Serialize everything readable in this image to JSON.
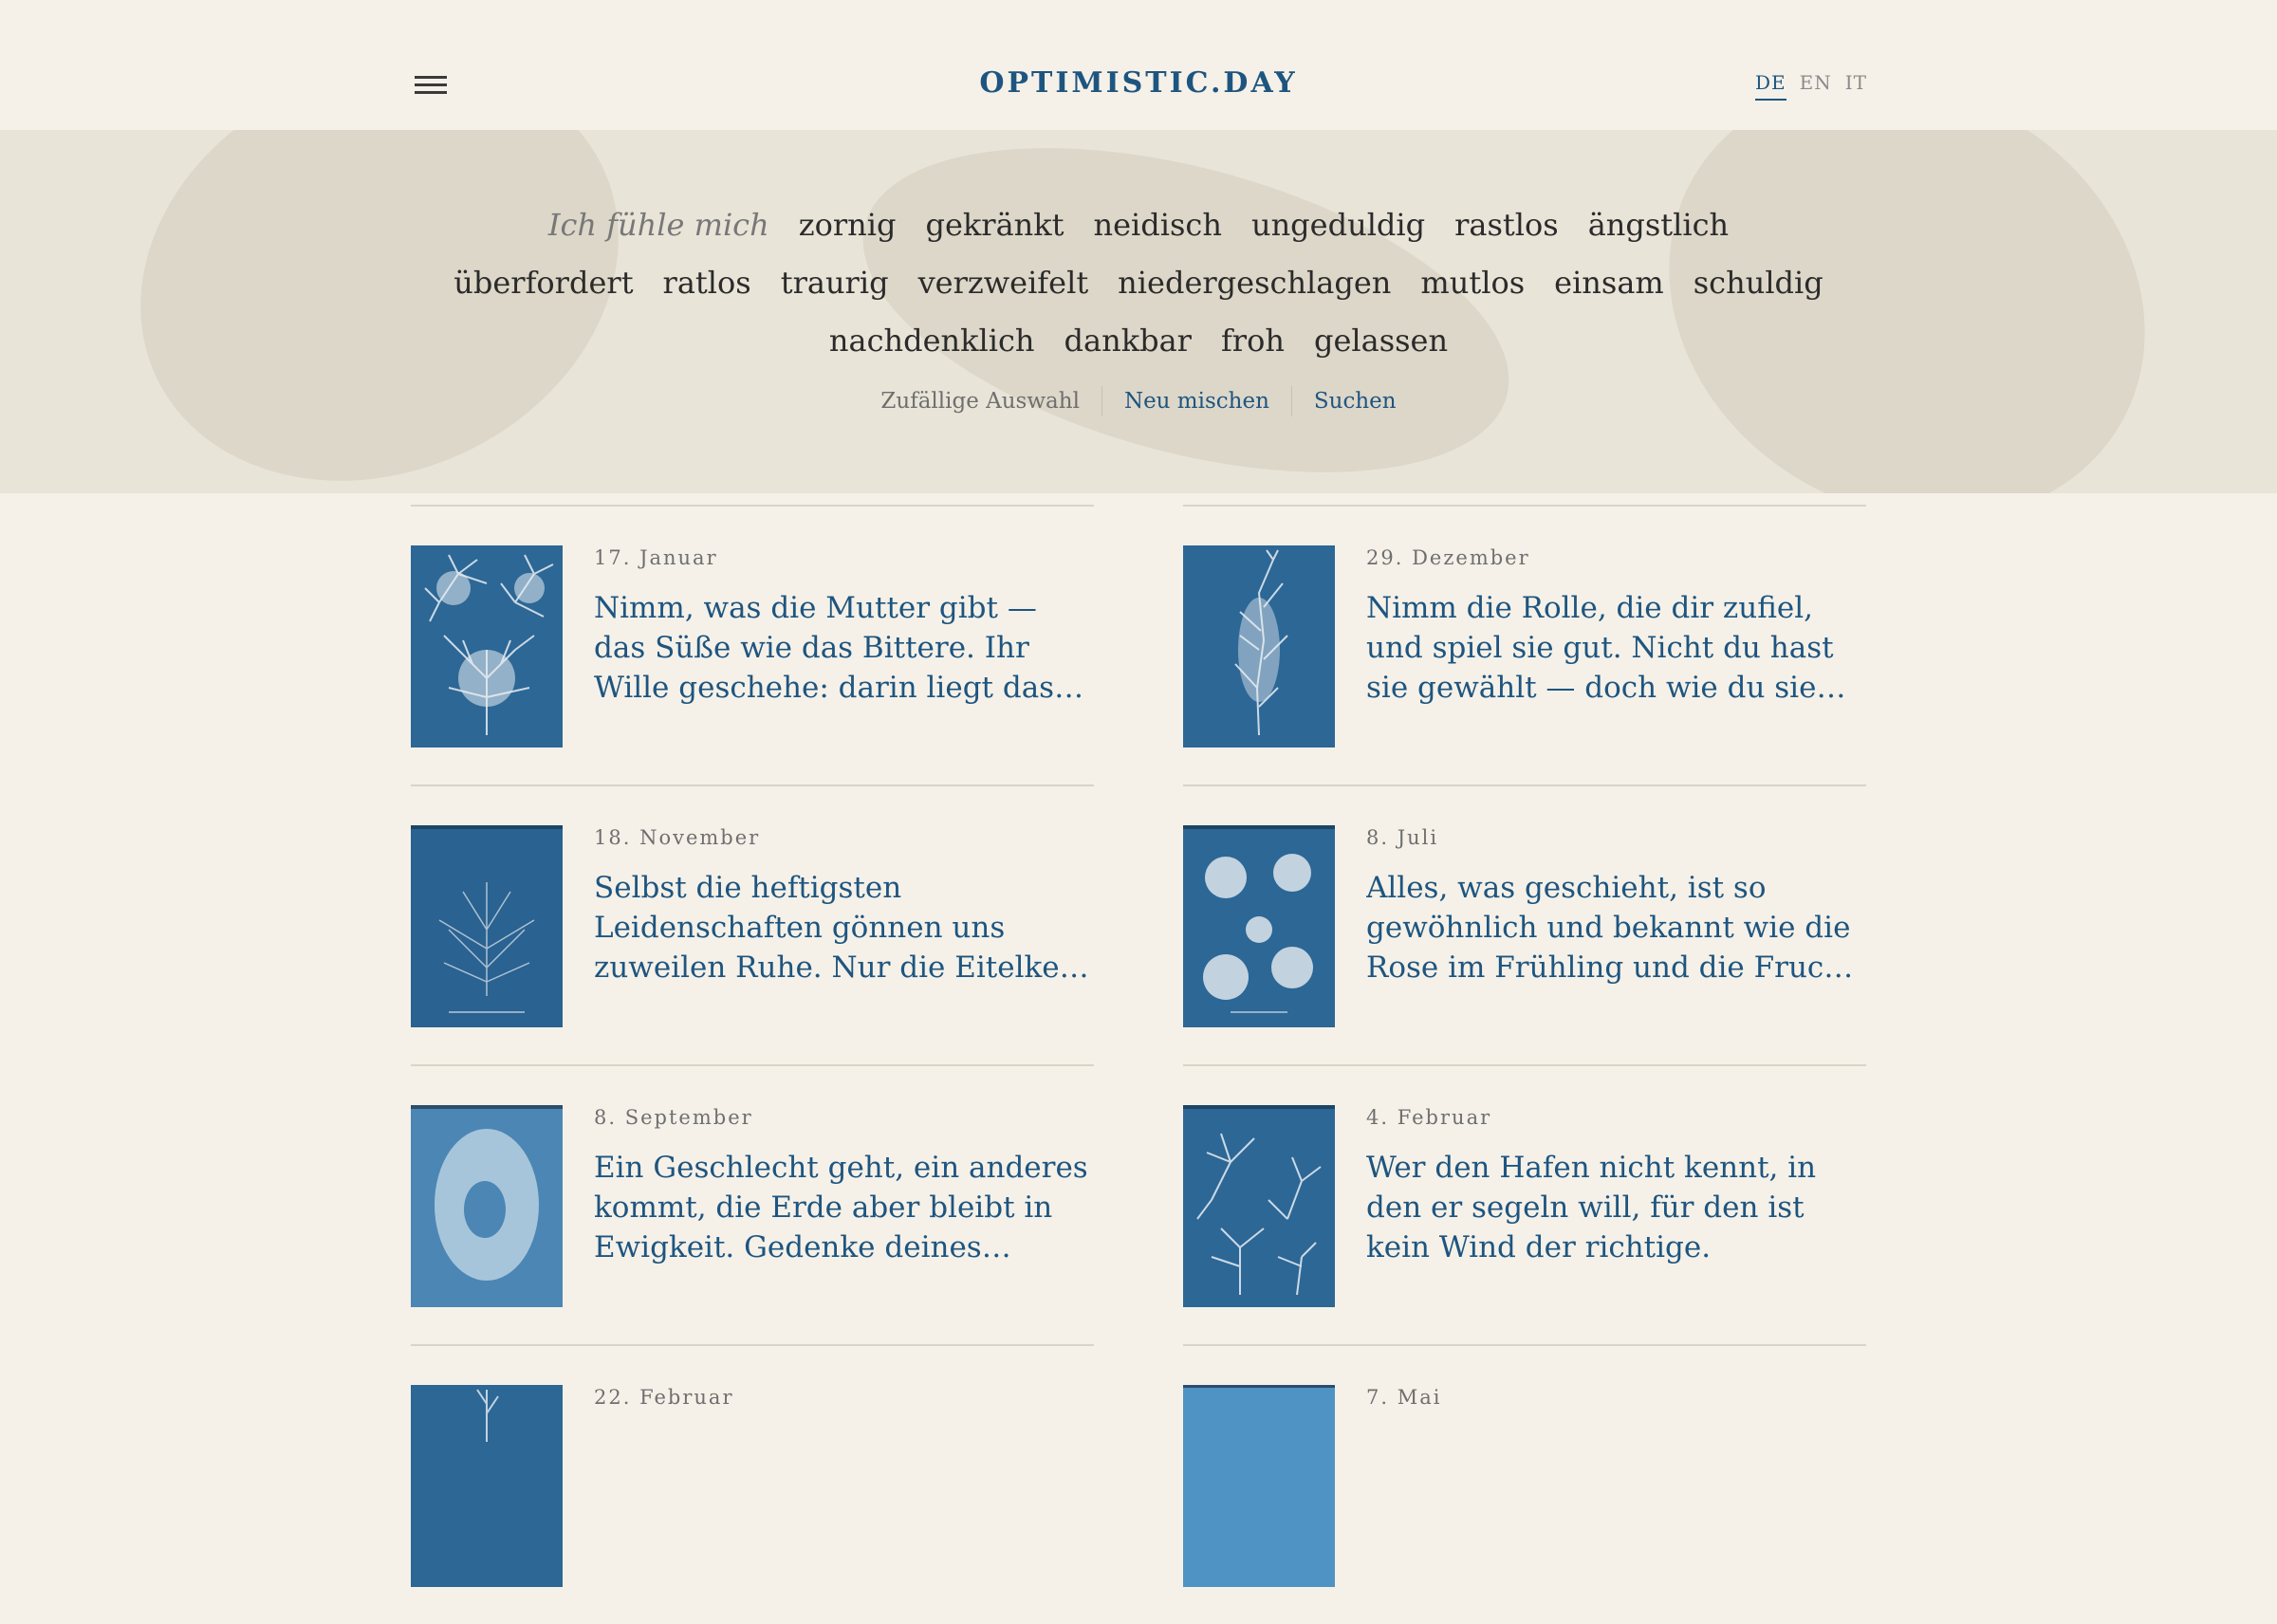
{
  "header": {
    "logo": "OPTIMISTIC.DAY",
    "languages": [
      "DE",
      "EN",
      "IT"
    ],
    "active_language": "DE"
  },
  "moods": {
    "lead": "Ich fühle mich",
    "row1": [
      "zornig",
      "gekränkt",
      "neidisch",
      "ungeduldig",
      "rastlos",
      "ängstlich"
    ],
    "row2": [
      "überfordert",
      "ratlos",
      "traurig",
      "verzweifelt",
      "niedergeschlagen",
      "mutlos",
      "einsam",
      "schuldig"
    ],
    "row3": [
      "nachdenklich",
      "dankbar",
      "froh",
      "gelassen"
    ]
  },
  "actions": {
    "random": "Zufällige Auswahl",
    "shuffle": "Neu mischen",
    "search": "Suchen"
  },
  "cards": [
    {
      "date": "17. Januar",
      "quote": "Nimm, was die Mutter gibt — das Süße wie das Bittere. Ihr Wille geschehe: darin liegt das Glück des Lebens."
    },
    {
      "date": "29. Dezember",
      "quote": "Nimm die Rolle, die dir zufiel, und spiel sie gut. Nicht du hast sie gewählt — doch wie du sie gibst, das liegt bei dir."
    },
    {
      "date": "18. November",
      "quote": "Selbst die heftigsten Leidenschaften gönnen uns zuweilen Ruhe. Nur die Eitelkeit lässt uns niemals in Frieden."
    },
    {
      "date": "8. Juli",
      "quote": "Alles, was geschieht, ist so gewöhnlich und bekannt wie die Rose im Frühling und die Frucht im Sommer."
    },
    {
      "date": "8. September",
      "quote": "Ein Geschlecht geht, ein anderes kommt, die Erde aber bleibt in Ewigkeit. Gedenke deines Schöpfers in deiner Jugend."
    },
    {
      "date": "4. Februar",
      "quote": "Wer den Hafen nicht kennt, in den er segeln will, für den ist kein Wind der richtige."
    },
    {
      "date": "22. Februar",
      "quote": ""
    },
    {
      "date": "7. Mai",
      "quote": ""
    }
  ],
  "colors": {
    "accent": "#1e5580",
    "background": "#f5f1e8",
    "band": "#e9e4d8",
    "cyanotype": "#2c6796"
  }
}
